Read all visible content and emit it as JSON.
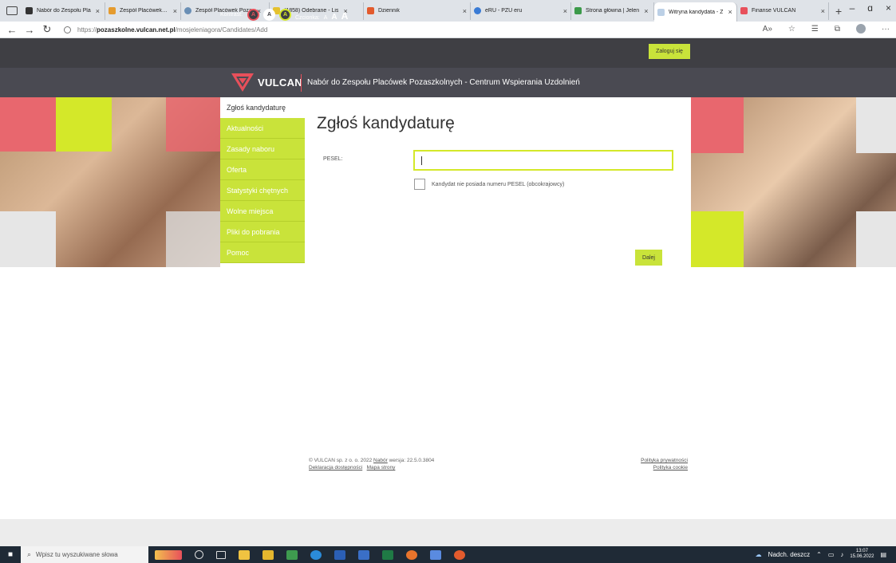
{
  "browser": {
    "tabs": [
      {
        "title": "Nabór do Zespołu Pla",
        "favicon_color": "#333333"
      },
      {
        "title": "Zespół Placówek Poza",
        "favicon_color": "#e59b2e"
      },
      {
        "title": "Zespół Placówek Poza",
        "favicon_color": "#6a8fb5"
      },
      {
        "title": "(1858) Odebrane - Lis",
        "favicon_color": "#e5c12e"
      },
      {
        "title": "Dziennik",
        "favicon_color": "#e35b2d"
      },
      {
        "title": "eRU - PZU eru",
        "favicon_color": "#3a7bd5"
      },
      {
        "title": "Strona główna | Jelen",
        "favicon_color": "#3c9a4a"
      },
      {
        "title": "Witryna kandydata - Z",
        "favicon_color": "#bcd0e6",
        "active": true
      },
      {
        "title": "Finanse VULCAN",
        "favicon_color": "#e8505b"
      }
    ],
    "url_prefix": "https://",
    "url_host": "pozaszkolne.vulcan.net.pl",
    "url_path": "/mosjeleniagora/Candidates/Add",
    "new_tab": "+",
    "minimize": "–",
    "restore": "ɑ",
    "close": "×"
  },
  "header": {
    "contrast_label": "Kontrast:",
    "contrast_buttons": [
      "A",
      "A",
      "A"
    ],
    "font_label": "Czcionka:",
    "font_sizes": [
      "A",
      "A",
      "A"
    ],
    "login_label": "Zaloguj się",
    "logo_text": "VULCAN",
    "site_title": "Nabór do Zespołu Placówek Pozaszkolnych - Centrum Wspierania Uzdolnień"
  },
  "menu": {
    "items": [
      "Zgłoś kandydaturę",
      "Aktualności",
      "Zasady naboru",
      "Oferta",
      "Statystyki chętnych",
      "Wolne miejsca",
      "Pliki do pobrania",
      "Pomoc"
    ]
  },
  "form": {
    "title": "Zgłoś kandydaturę",
    "pesel_label": "PESEL:",
    "pesel_value": "",
    "foreign_label": "Kandydat nie posiada numeru PESEL (obcokrajowcy)",
    "foreign_checked": false,
    "next_label": "Dalej"
  },
  "footer": {
    "copyright": "© VULCAN sp. z o. o. 2022",
    "nabor_link": "Nabór",
    "version": "wersja: 22.5.0.3804",
    "accessibility_link": "Deklaracja dostępności",
    "sitemap_link": "Mapa strony",
    "privacy_link": "Polityka prywatności",
    "cookie_link": "Polityka cookie"
  },
  "taskbar": {
    "search_placeholder": "Wpisz tu wyszukiwane słowa",
    "weather": "Nadch. deszcz",
    "time": "13:07",
    "date": "15.06.2022"
  },
  "colors": {
    "accent_green": "#c9e33a",
    "accent_red": "#e8505b",
    "header_dark": "#3f3f44"
  }
}
